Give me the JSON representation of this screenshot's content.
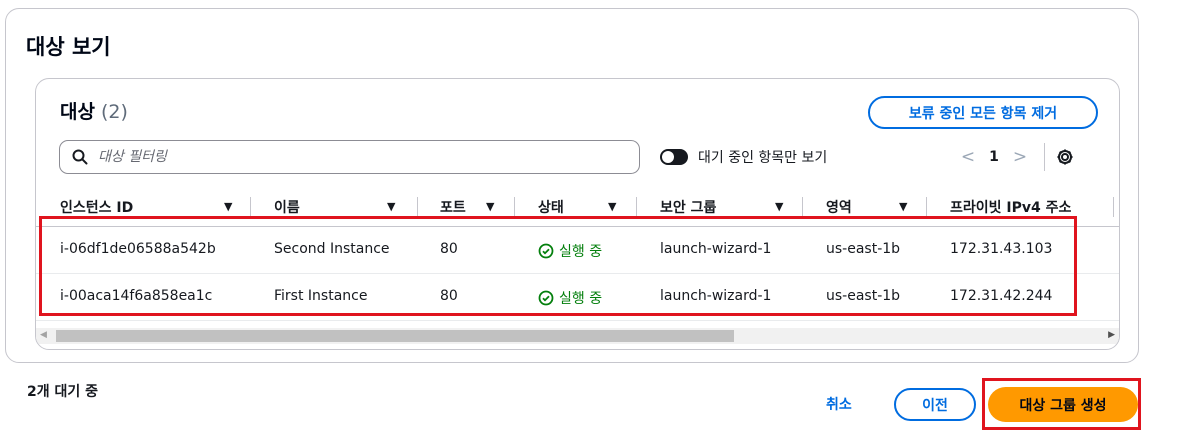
{
  "section": {
    "title": "대상 보기"
  },
  "targets": {
    "title": "대상",
    "count": "(2)",
    "remove_all_label": "보류 중인 모든 항목 제거",
    "filter_placeholder": "대상 필터링",
    "toggle_label": "대기 중인 항목만 보기",
    "toggle_on": true,
    "pager": {
      "prev": "<",
      "current": "1",
      "next": ">"
    },
    "columns": [
      {
        "label": "인스턴스 ID",
        "sort": "▼"
      },
      {
        "label": "이름",
        "sort": "▼"
      },
      {
        "label": "포트",
        "sort": "▼"
      },
      {
        "label": "상태",
        "sort": "▼"
      },
      {
        "label": "보안 그룹",
        "sort": "▼"
      },
      {
        "label": "영역",
        "sort": "▼"
      },
      {
        "label": "프라이빗 IPv4 주소",
        "sort": ""
      }
    ],
    "rows": [
      {
        "instance_id": "i-06df1de06588a542b",
        "name": "Second Instance",
        "port": "80",
        "status": "실행 중",
        "security_group": "launch-wizard-1",
        "zone": "us-east-1b",
        "ipv4": "172.31.43.103"
      },
      {
        "instance_id": "i-00aca14f6a858ea1c",
        "name": "First Instance",
        "port": "80",
        "status": "실행 중",
        "security_group": "launch-wizard-1",
        "zone": "us-east-1b",
        "ipv4": "172.31.42.244"
      }
    ]
  },
  "footer": {
    "pending": "2개 대기 중",
    "cancel_label": "취소",
    "prev_label": "이전",
    "create_label": "대상 그룹 생성"
  },
  "colors": {
    "accent": "#006ce0",
    "primary_button": "#ff9900",
    "status_running": "#037f0c",
    "highlight": "#e0141e"
  }
}
